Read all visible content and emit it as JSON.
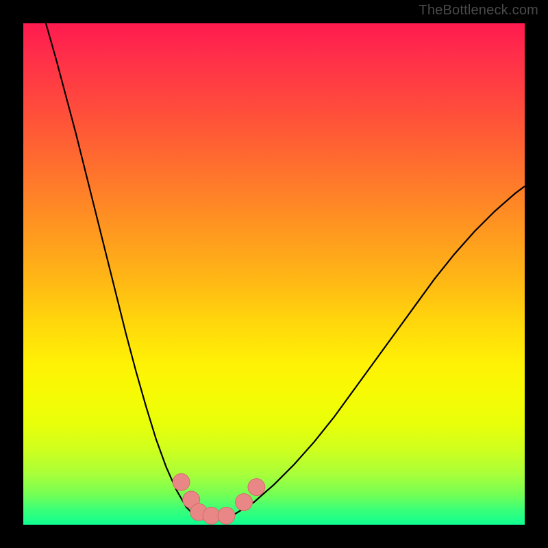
{
  "watermark": "TheBottleneck.com",
  "chart_data": {
    "type": "line",
    "title": "",
    "xlabel": "",
    "ylabel": "",
    "xlim": [
      0,
      100
    ],
    "ylim": [
      0,
      100
    ],
    "series": [
      {
        "name": "left-branch",
        "x": [
          4.5,
          6.5,
          8.5,
          10.5,
          12.5,
          14.5,
          16.5,
          18.5,
          20.5,
          22.5,
          24.5,
          26.5,
          28.5,
          30.5,
          32.5,
          34.0
        ],
        "values": [
          100.0,
          93.0,
          85.5,
          78.0,
          70.0,
          62.0,
          54.0,
          46.0,
          38.0,
          30.5,
          23.5,
          17.0,
          11.5,
          7.0,
          3.5,
          2.0
        ]
      },
      {
        "name": "valley-floor",
        "x": [
          34.0,
          36.0,
          38.0,
          40.0,
          42.0
        ],
        "values": [
          2.0,
          1.5,
          1.5,
          1.5,
          2.0
        ]
      },
      {
        "name": "right-branch",
        "x": [
          42.0,
          46.0,
          50.0,
          54.0,
          58.0,
          62.0,
          66.0,
          70.0,
          74.0,
          78.0,
          82.0,
          86.0,
          90.0,
          94.0,
          98.0,
          100.0
        ],
        "values": [
          2.0,
          4.5,
          8.0,
          12.0,
          16.5,
          21.5,
          27.0,
          32.5,
          38.0,
          43.5,
          49.0,
          54.0,
          58.5,
          62.5,
          66.0,
          67.5
        ]
      }
    ],
    "markers": [
      {
        "name": "dot-left-1",
        "x": 31.5,
        "y": 8.5,
        "r": 1.7
      },
      {
        "name": "dot-left-2",
        "x": 33.5,
        "y": 5.0,
        "r": 1.7
      },
      {
        "name": "dot-left-3",
        "x": 35.0,
        "y": 2.5,
        "r": 1.7
      },
      {
        "name": "dot-bottom-1",
        "x": 37.5,
        "y": 1.8,
        "r": 1.7
      },
      {
        "name": "dot-bottom-2",
        "x": 40.5,
        "y": 1.8,
        "r": 1.7
      },
      {
        "name": "dot-right-1",
        "x": 44.0,
        "y": 4.5,
        "r": 1.7
      },
      {
        "name": "dot-right-2",
        "x": 46.5,
        "y": 7.5,
        "r": 1.7
      }
    ],
    "colors": {
      "curve": "#000000",
      "marker_fill": "#e98787",
      "marker_stroke": "#d46c6c",
      "frame": "#000000"
    }
  }
}
